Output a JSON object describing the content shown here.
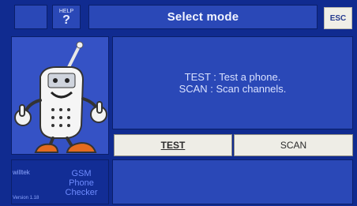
{
  "header": {
    "help_small_label": "HELP",
    "help_label": "?",
    "title": "Select mode",
    "esc_label": "ESC"
  },
  "message": {
    "lines": [
      "TEST : Test a phone.",
      "SCAN : Scan channels."
    ]
  },
  "buttons": {
    "test_label": "TEST",
    "scan_label": "SCAN"
  },
  "footer": {
    "brand": "willtek",
    "app_name_lines": [
      "GSM",
      "Phone",
      "Checker"
    ],
    "version": "Version 1.18"
  }
}
